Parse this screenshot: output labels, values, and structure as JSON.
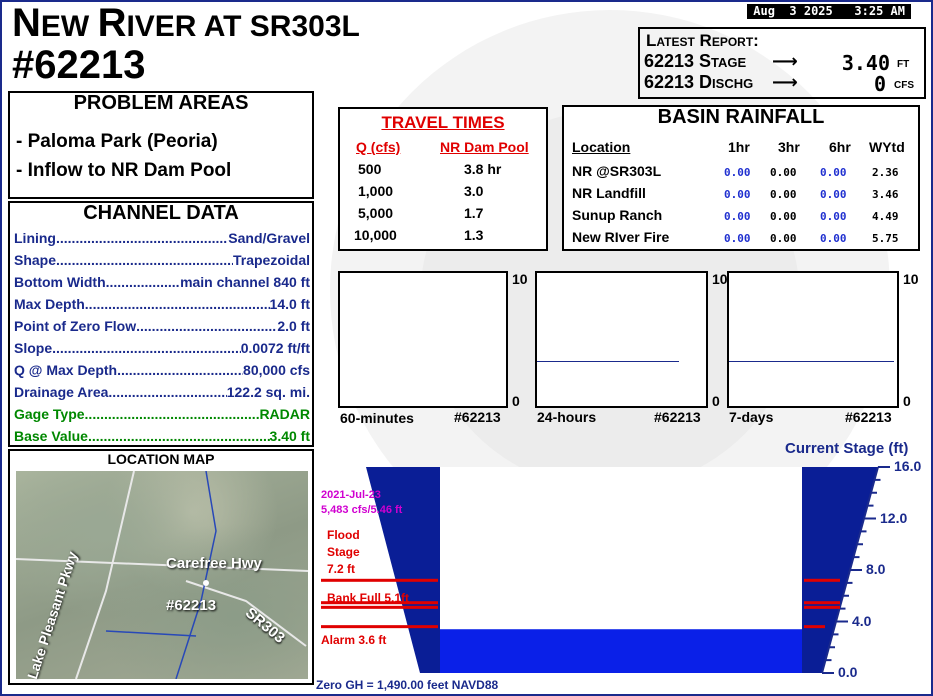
{
  "header": {
    "title_line1_a": "N",
    "title_line1_b": "EW ",
    "title_line1_c": "R",
    "title_line1_d": "IVER AT SR303L",
    "title_line2": "#62213",
    "datetime": "Aug  3 2025   3:25 AM"
  },
  "latest_report": {
    "heading": "Latest Report:",
    "stage_label": "62213 Stage",
    "stage_value": "3.40",
    "stage_unit": "FT",
    "disch_label": "62213 Dischg",
    "disch_value": "0",
    "disch_unit": "CFS",
    "arrow": "⟶"
  },
  "problem_areas": {
    "heading": "PROBLEM AREAS",
    "items": [
      "- Paloma Park (Peoria)",
      "- Inflow to NR Dam Pool"
    ]
  },
  "channel_data": {
    "heading": "CHANNEL DATA",
    "rows": [
      {
        "label": "Lining ",
        "value": " Sand/Gravel"
      },
      {
        "label": "Shape ",
        "value": " Trapezoidal"
      },
      {
        "label": "Bottom Width ",
        "value": "main channel 840 ft"
      },
      {
        "label": "Max Depth",
        "value": " 14.0 ft"
      },
      {
        "label": "Point of Zero Flow",
        "value": " 2.0 ft"
      },
      {
        "label": "Slope ",
        "value": " 0.0072 ft/ft"
      },
      {
        "label": "Q @ Max Depth",
        "value": " 80,000 cfs"
      },
      {
        "label": "Drainage Area ",
        "value": " 122.2 sq. mi."
      },
      {
        "label": "Gage Type ",
        "value": " RADAR"
      },
      {
        "label": "Base Value ",
        "value": " 3.40 ft"
      }
    ]
  },
  "location_map": {
    "heading": "LOCATION MAP",
    "labels": [
      "Carefree Hwy",
      "#62213",
      "SR303",
      "Lake Pleasant Pkwy"
    ]
  },
  "travel_times": {
    "heading": "TRAVEL TIMES",
    "col1": "Q (cfs)",
    "col2": "NR Dam Pool",
    "rows": [
      {
        "q": "500",
        "t": "3.8 hr"
      },
      {
        "q": "1,000",
        "t": "3.0"
      },
      {
        "q": "5,000",
        "t": "1.7"
      },
      {
        "q": "10,000",
        "t": "1.3"
      }
    ]
  },
  "basin_rainfall": {
    "heading": "BASIN RAINFALL",
    "columns": [
      "Location",
      "1hr",
      "3hr",
      "6hr",
      "WYtd"
    ],
    "rows": [
      {
        "loc": "NR @SR303L",
        "h1": "0.00",
        "h3": "0.00",
        "h6": "0.00",
        "wy": "2.36"
      },
      {
        "loc": "NR Landfill",
        "h1": "0.00",
        "h3": "0.00",
        "h6": "0.00",
        "wy": "3.46"
      },
      {
        "loc": "Sunup Ranch",
        "h1": "0.00",
        "h3": "0.00",
        "h6": "0.00",
        "wy": "4.49"
      },
      {
        "loc": "New RIver Fire",
        "h1": "0.00",
        "h3": "0.00",
        "h6": "0.00",
        "wy": "5.75"
      }
    ]
  },
  "rain_charts": [
    {
      "period": "60-minutes",
      "gage": "#62213",
      "ymax": "10",
      "ymin": "0"
    },
    {
      "period": "24-hours",
      "gage": "#62213",
      "ymax": "10",
      "ymin": "0"
    },
    {
      "period": "7-days",
      "gage": "#62213",
      "ymax": "10",
      "ymin": "0"
    }
  ],
  "stage_gauge": {
    "heading": "Current Stage (ft)",
    "ticks": [
      "16.0",
      "12.0",
      "8.0",
      "4.0",
      "0.0"
    ],
    "record_date": "2021-Jul-23",
    "record_value": "5,483 cfs/5.46 ft",
    "flood_stage_a": "Flood",
    "flood_stage_b": "Stage",
    "flood_stage_c": "7.2 ft",
    "bank_full": "Bank Full 5.1ft",
    "alarm": "Alarm 3.6 ft",
    "zero_gh": "Zero GH = 1,490.00 feet NAVD88",
    "current_stage_ft": 3.4,
    "max_ft": 16.0
  },
  "colors": {
    "navy": "#1a2a8c",
    "water": "#0a20e8",
    "red": "#e00000",
    "green": "#008800",
    "magenta": "#d000d0"
  }
}
